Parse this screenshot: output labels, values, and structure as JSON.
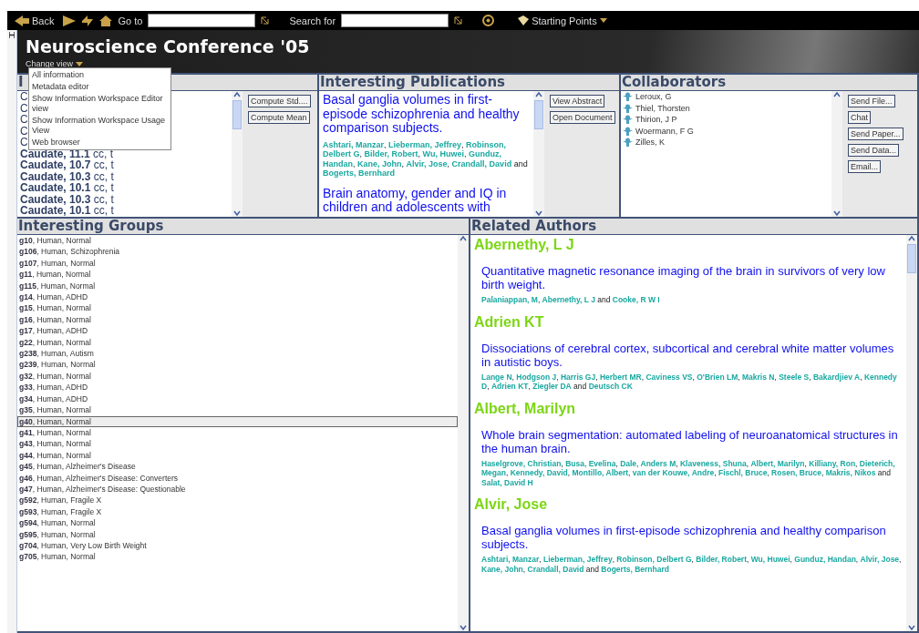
{
  "toolbar": {
    "back": "Back",
    "goto_label": "Go to",
    "search_label": "Search for",
    "starting_points": "Starting Points"
  },
  "header": {
    "title": "Neuroscience Conference '05",
    "change_view": "Change view"
  },
  "view_menu": [
    "All information",
    "Metadata editor",
    "Show Information Workspace Editor view",
    "Show Information Workspace Usage View",
    "Web browser"
  ],
  "measures_panel": {
    "title": "I",
    "rows": [
      "C",
      "C",
      "C",
      "C",
      "C",
      "**Caudate, 11.1** cc, t",
      "**Caudate, 10.7** cc, t",
      "**Caudate, 10.3** cc, t",
      "**Caudate, 10.1** cc, t",
      "**Caudate, 10.3** cc, t",
      "**Caudate, 10.1** cc, t"
    ],
    "buttons": [
      "Compute Std....",
      "Compute Mean"
    ]
  },
  "publications_panel": {
    "title": "Interesting Publications",
    "items": [
      {
        "title": "Basal ganglia volumes in first-episode schizophrenia and healthy comparison subjects.",
        "authors": "**Ashtari, Manzar**, **Lieberman, Jeffrey**, **Robinson, Delbert G**, **Bilder, Robert**, **Wu, Huwei**, **Gunduz, Handan**, **Kane, John**, **Alvir, Jose**, **Crandall, David** and **Bogerts, Bernhard**"
      },
      {
        "title": "Brain anatomy, gender and IQ in children and adolescents with"
      }
    ],
    "buttons": [
      "View Abstract",
      "Open Document"
    ]
  },
  "collaborators_panel": {
    "title": "Collaborators",
    "people": [
      "Leroux, G",
      "Thiel, Thorsten",
      "Thirion, J P",
      "Woermann, F G",
      "Zilles, K"
    ],
    "buttons": [
      "Send File...",
      "Chat",
      "Send Paper...",
      "Send Data...",
      "Email..."
    ]
  },
  "groups_panel": {
    "title": "Interesting Groups",
    "items": [
      {
        "text": "**g10**, Human, Normal",
        "selected": false
      },
      {
        "text": "**g106**, Human, Schizophrenia",
        "selected": false
      },
      {
        "text": "**g107**, Human, Normal",
        "selected": false
      },
      {
        "text": "**g11**, Human, Normal",
        "selected": false
      },
      {
        "text": "**g115**, Human, Normal",
        "selected": false
      },
      {
        "text": "**g14**, Human, ADHD",
        "selected": false
      },
      {
        "text": "**g15**, Human, Normal",
        "selected": false
      },
      {
        "text": "**g16**, Human, Normal",
        "selected": false
      },
      {
        "text": "**g17**, Human, ADHD",
        "selected": false
      },
      {
        "text": "**g22**, Human, Normal",
        "selected": false
      },
      {
        "text": "**g238**, Human, Autism",
        "selected": false
      },
      {
        "text": "**g239**, Human, Normal",
        "selected": false
      },
      {
        "text": "**g32**, Human, Normal",
        "selected": false
      },
      {
        "text": "**g33**, Human, ADHD",
        "selected": false
      },
      {
        "text": "**g34**, Human, ADHD",
        "selected": false
      },
      {
        "text": "**g35**, Human, Normal",
        "selected": false
      },
      {
        "text": "**g40**, Human, Normal",
        "selected": true
      },
      {
        "text": "**g41**, Human, Normal",
        "selected": false
      },
      {
        "text": "**g43**, Human, Normal",
        "selected": false
      },
      {
        "text": "**g44**, Human, Normal",
        "selected": false
      },
      {
        "text": "**g45**, Human, Alzheimer's Disease",
        "selected": false
      },
      {
        "text": "**g46**, Human, Alzheimer's Disease: Converters",
        "selected": false
      },
      {
        "text": "**g47**, Human, Alzheimer's Disease: Questionable",
        "selected": false
      },
      {
        "text": "**g592**, Human, Fragile X",
        "selected": false
      },
      {
        "text": "**g593**, Human, Fragile X",
        "selected": false
      },
      {
        "text": "**g594**, Human, Normal",
        "selected": false
      },
      {
        "text": "**g595**, Human, Normal",
        "selected": false
      },
      {
        "text": "**g704**, Human, Very Low Birth Weight",
        "selected": false
      },
      {
        "text": "**g705**, Human, Normal",
        "selected": false
      }
    ]
  },
  "related_authors_panel": {
    "title": "Related Authors",
    "authors": [
      {
        "name": "Abernethy, L J",
        "title": "Quantitative magnetic resonance imaging of the brain in survivors of very low birth weight.",
        "authors": "**Palaniappan, M**, **Abernethy, L J** and **Cooke, R W I**"
      },
      {
        "name": "Adrien KT",
        "title": "Dissociations of cerebral cortex, subcortical and cerebral white matter volumes in autistic boys.",
        "authors": "**Lange N**, **Hodgson J**, **Harris GJ**, **Herbert MR**, **Caviness VS**, **O'Brien LM**, **Makris N**, **Steele S**, **Bakardjiev A**, **Kennedy D**, **Adrien KT**, **Ziegler DA** and **Deutsch CK**"
      },
      {
        "name": "Albert, Marilyn",
        "title": "Whole brain segmentation: automated labeling of neuroanatomical structures in the human brain.",
        "authors": "**Haselgrove, Christian**, **Busa, Evelina**, **Dale, Anders M**, **Klaveness, Shuna**, **Albert, Marilyn**, **Killiany, Ron**, **Dieterich, Megan**, **Kennedy, David**, **Montillo, Albert**, **van der Kouwe, Andre**, **Fischl, Bruce**, **Rosen, Bruce**, **Makris, Nikos** and **Salat, David H**"
      },
      {
        "name": "Alvir, Jose",
        "title": "Basal ganglia volumes in first-episode schizophrenia and healthy comparison subjects.",
        "authors": "**Ashtari, Manzar**, **Lieberman, Jeffrey**, **Robinson, Delbert G**, **Bilder, Robert**, **Wu, Huwei**, **Gunduz, Handan**, **Alvir, Jose**, **Kane, John**, **Crandall, David** and **Bogerts, Bernhard**"
      }
    ]
  }
}
